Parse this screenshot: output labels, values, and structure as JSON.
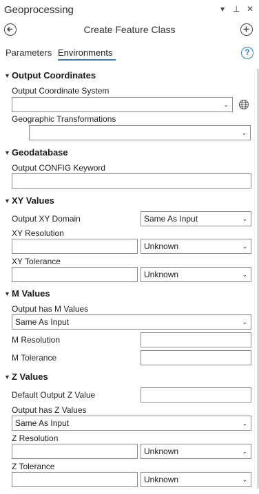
{
  "pane": {
    "title": "Geoprocessing",
    "controls": {
      "menu": "▾",
      "pin": "⊥",
      "close": "✕"
    }
  },
  "tool": {
    "title": "Create Feature Class"
  },
  "tabs": [
    {
      "label": "Parameters",
      "active": false
    },
    {
      "label": "Environments",
      "active": true
    }
  ],
  "help": "?",
  "chevron": "▼",
  "dropdown_arrow": "⌄",
  "sections": {
    "output_coordinates": {
      "heading": "Output Coordinates",
      "coord_system_label": "Output Coordinate System",
      "coord_system_value": "",
      "geo_trans_label": "Geographic Transformations",
      "geo_trans_value": ""
    },
    "geodatabase": {
      "heading": "Geodatabase",
      "config_label": "Output CONFIG Keyword",
      "config_value": ""
    },
    "xy_values": {
      "heading": "XY Values",
      "domain_label": "Output XY Domain",
      "domain_value": "Same As Input",
      "resolution_label": "XY Resolution",
      "resolution_value": "",
      "resolution_unit": "Unknown",
      "tolerance_label": "XY Tolerance",
      "tolerance_value": "",
      "tolerance_unit": "Unknown"
    },
    "m_values": {
      "heading": "M Values",
      "has_m_label": "Output has M Values",
      "has_m_value": "Same As Input",
      "resolution_label": "M Resolution",
      "resolution_value": "",
      "tolerance_label": "M Tolerance",
      "tolerance_value": ""
    },
    "z_values": {
      "heading": "Z Values",
      "default_z_label": "Default Output Z Value",
      "default_z_value": "",
      "has_z_label": "Output has Z Values",
      "has_z_value": "Same As Input",
      "resolution_label": "Z Resolution",
      "resolution_value": "",
      "resolution_unit": "Unknown",
      "tolerance_label": "Z Tolerance",
      "tolerance_value": "",
      "tolerance_unit": "Unknown"
    }
  },
  "colors": {
    "accent": "#2f7fc1",
    "border": "#8c8c8c"
  }
}
